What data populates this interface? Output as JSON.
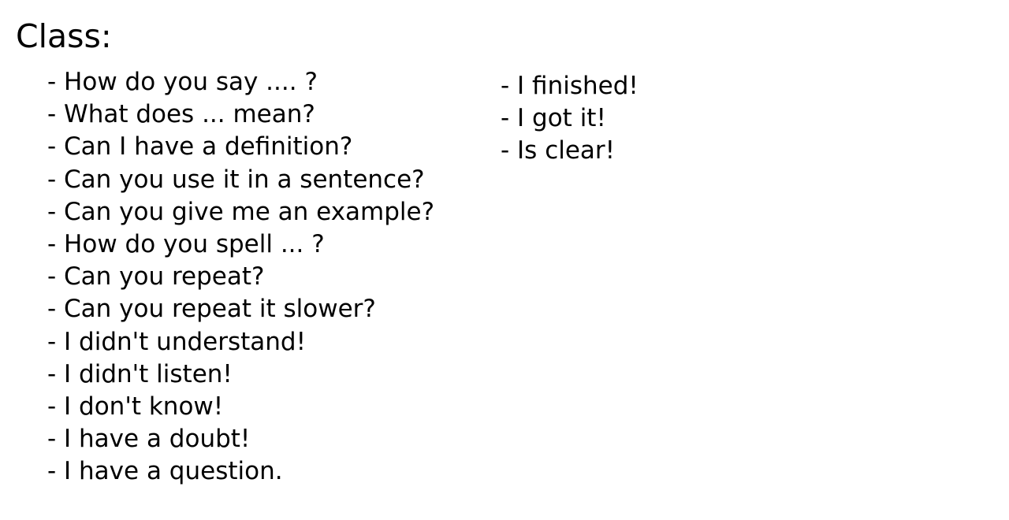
{
  "slide": {
    "title": "Class:",
    "left_phrases": [
      "- How do you say .... ?",
      "- What does ... mean?",
      "- Can I have a definition?",
      "- Can you use it in a sentence?",
      "- Can you give me an example?",
      "- How do you spell ... ?",
      "- Can you repeat?",
      "- Can you repeat it slower?",
      "- I didn't understand!",
      "- I didn't listen!",
      "- I don't know!",
      "- I have a doubt!",
      "- I have a question."
    ],
    "right_phrases": [
      "- I finished!",
      "- I got it!",
      "- Is clear!"
    ]
  }
}
